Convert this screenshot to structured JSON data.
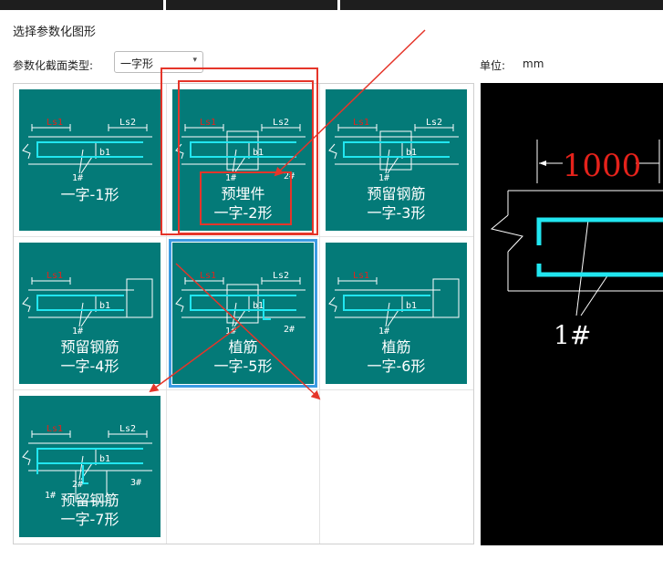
{
  "dialog": {
    "title": "选择参数化图形",
    "section_type_label": "参数化截面类型:",
    "section_type_value": "一字形",
    "unit_label": "单位:",
    "unit_value": "mm"
  },
  "tiles": [
    {
      "name": "一字-1形",
      "line1": "",
      "line2": "一字-1形",
      "ls1": "Ls1",
      "ls2": "Ls2",
      "b1": "b1",
      "marks": [
        "1#"
      ]
    },
    {
      "name": "预埋件一字-2形",
      "line1": "预埋件",
      "line2": "一字-2形",
      "ls1": "Ls1",
      "ls2": "Ls2",
      "b1": "b1",
      "marks": [
        "1#",
        "2#"
      ]
    },
    {
      "name": "预留钢筋一字-3形",
      "line1": "预留钢筋",
      "line2": "一字-3形",
      "ls1": "Ls1",
      "ls2": "Ls2",
      "b1": "b1",
      "marks": [
        "1#"
      ]
    },
    {
      "name": "预留钢筋一字-4形",
      "line1": "预留钢筋",
      "line2": "一字-4形",
      "ls1": "Ls1",
      "ls2": "",
      "b1": "b1",
      "marks": [
        "1#"
      ]
    },
    {
      "name": "植筋一字-5形",
      "line1": "植筋",
      "line2": "一字-5形",
      "ls1": "Ls1",
      "ls2": "Ls2",
      "b1": "b1",
      "marks": [
        "1#",
        "2#"
      ]
    },
    {
      "name": "植筋一字-6形",
      "line1": "植筋",
      "line2": "一字-6形",
      "ls1": "Ls1",
      "ls2": "",
      "b1": "b1",
      "marks": [
        "1#"
      ]
    },
    {
      "name": "预留钢筋一字-7形",
      "line1": "预留钢筋",
      "line2": "一字-7形",
      "ls1": "Ls1",
      "ls2": "Ls2",
      "b1": "b1",
      "marks": [
        "2#",
        "3#",
        "1#"
      ]
    }
  ],
  "selected_tile": 4,
  "preview": {
    "dimension": "1000",
    "mark": "1#"
  },
  "colors": {
    "tile_bg": "#047a78",
    "rebar": "#21e6f0",
    "dim_red": "#e4221b",
    "selection": "#3c9be3",
    "annotation": "#e5352a"
  }
}
